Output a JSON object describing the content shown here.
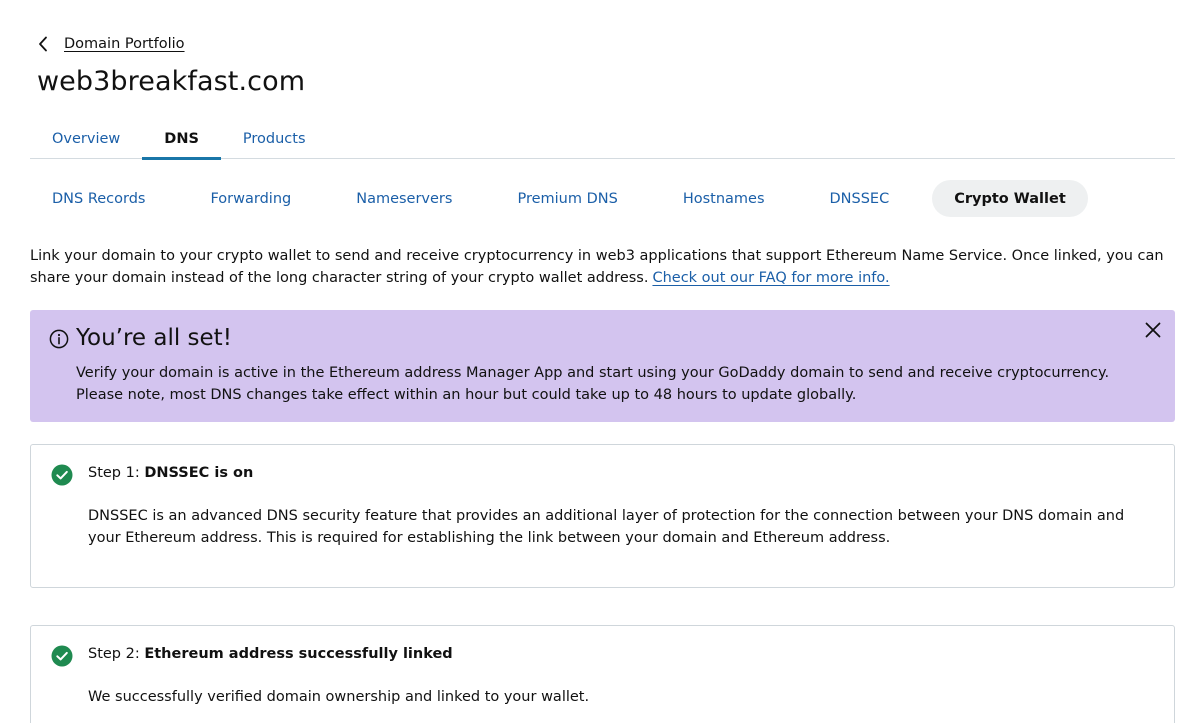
{
  "breadcrumb": {
    "label": "Domain Portfolio",
    "icon": "chevron-left-icon"
  },
  "page": {
    "title": "web3breakfast.com"
  },
  "tabs": [
    {
      "label": "Overview",
      "active": false
    },
    {
      "label": "DNS",
      "active": true
    },
    {
      "label": "Products",
      "active": false
    }
  ],
  "subnav": [
    {
      "label": "DNS Records",
      "active": false
    },
    {
      "label": "Forwarding",
      "active": false
    },
    {
      "label": "Nameservers",
      "active": false
    },
    {
      "label": "Premium DNS",
      "active": false
    },
    {
      "label": "Hostnames",
      "active": false
    },
    {
      "label": "DNSSEC",
      "active": false
    },
    {
      "label": "Crypto Wallet",
      "active": true
    }
  ],
  "intro": {
    "text": "Link your domain to your crypto wallet to send and receive cryptocurrency in web3 applications that support Ethereum Name Service. Once linked, you can share your domain instead of the long character string of your crypto wallet address.",
    "link": "Check out our FAQ for more info."
  },
  "alert": {
    "title": "You’re all set!",
    "body": "Verify your domain is active in the Ethereum address Manager App and start using your GoDaddy domain to send and receive cryptocurrency. Please note, most DNS changes take effect within an hour but could take up to 48 hours to update globally.",
    "icon": "info-icon",
    "close_icon": "close-icon"
  },
  "steps": [
    {
      "prefix": "Step 1: ",
      "title": "DNSSEC is on",
      "body": "DNSSEC is an advanced DNS security feature that provides an additional layer of protection for the connection between your DNS domain and your Ethereum address. This is required for establishing the link between your domain and Ethereum address.",
      "icon": "check-circle-icon"
    },
    {
      "prefix": "Step 2: ",
      "title": "Ethereum address successfully linked",
      "body": "We successfully verified domain ownership and linked to your wallet.",
      "icon": "check-circle-icon"
    }
  ],
  "colors": {
    "link": "#1b5fa8",
    "tab_underline": "#1976a8",
    "alert_bg": "#d3c4ef",
    "success": "#1f8a50",
    "pill_active_bg": "#eef0f1"
  }
}
